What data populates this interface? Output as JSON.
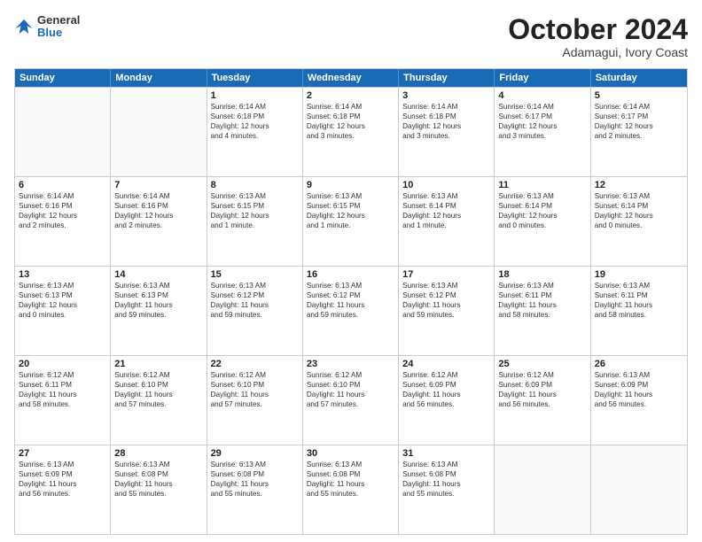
{
  "header": {
    "logo_general": "General",
    "logo_blue": "Blue",
    "month": "October 2024",
    "location": "Adamagui, Ivory Coast"
  },
  "days_of_week": [
    "Sunday",
    "Monday",
    "Tuesday",
    "Wednesday",
    "Thursday",
    "Friday",
    "Saturday"
  ],
  "rows": [
    [
      {
        "day": "",
        "lines": []
      },
      {
        "day": "",
        "lines": []
      },
      {
        "day": "1",
        "lines": [
          "Sunrise: 6:14 AM",
          "Sunset: 6:18 PM",
          "Daylight: 12 hours",
          "and 4 minutes."
        ]
      },
      {
        "day": "2",
        "lines": [
          "Sunrise: 6:14 AM",
          "Sunset: 6:18 PM",
          "Daylight: 12 hours",
          "and 3 minutes."
        ]
      },
      {
        "day": "3",
        "lines": [
          "Sunrise: 6:14 AM",
          "Sunset: 6:18 PM",
          "Daylight: 12 hours",
          "and 3 minutes."
        ]
      },
      {
        "day": "4",
        "lines": [
          "Sunrise: 6:14 AM",
          "Sunset: 6:17 PM",
          "Daylight: 12 hours",
          "and 3 minutes."
        ]
      },
      {
        "day": "5",
        "lines": [
          "Sunrise: 6:14 AM",
          "Sunset: 6:17 PM",
          "Daylight: 12 hours",
          "and 2 minutes."
        ]
      }
    ],
    [
      {
        "day": "6",
        "lines": [
          "Sunrise: 6:14 AM",
          "Sunset: 6:16 PM",
          "Daylight: 12 hours",
          "and 2 minutes."
        ]
      },
      {
        "day": "7",
        "lines": [
          "Sunrise: 6:14 AM",
          "Sunset: 6:16 PM",
          "Daylight: 12 hours",
          "and 2 minutes."
        ]
      },
      {
        "day": "8",
        "lines": [
          "Sunrise: 6:13 AM",
          "Sunset: 6:15 PM",
          "Daylight: 12 hours",
          "and 1 minute."
        ]
      },
      {
        "day": "9",
        "lines": [
          "Sunrise: 6:13 AM",
          "Sunset: 6:15 PM",
          "Daylight: 12 hours",
          "and 1 minute."
        ]
      },
      {
        "day": "10",
        "lines": [
          "Sunrise: 6:13 AM",
          "Sunset: 6:14 PM",
          "Daylight: 12 hours",
          "and 1 minute."
        ]
      },
      {
        "day": "11",
        "lines": [
          "Sunrise: 6:13 AM",
          "Sunset: 6:14 PM",
          "Daylight: 12 hours",
          "and 0 minutes."
        ]
      },
      {
        "day": "12",
        "lines": [
          "Sunrise: 6:13 AM",
          "Sunset: 6:14 PM",
          "Daylight: 12 hours",
          "and 0 minutes."
        ]
      }
    ],
    [
      {
        "day": "13",
        "lines": [
          "Sunrise: 6:13 AM",
          "Sunset: 6:13 PM",
          "Daylight: 12 hours",
          "and 0 minutes."
        ]
      },
      {
        "day": "14",
        "lines": [
          "Sunrise: 6:13 AM",
          "Sunset: 6:13 PM",
          "Daylight: 11 hours",
          "and 59 minutes."
        ]
      },
      {
        "day": "15",
        "lines": [
          "Sunrise: 6:13 AM",
          "Sunset: 6:12 PM",
          "Daylight: 11 hours",
          "and 59 minutes."
        ]
      },
      {
        "day": "16",
        "lines": [
          "Sunrise: 6:13 AM",
          "Sunset: 6:12 PM",
          "Daylight: 11 hours",
          "and 59 minutes."
        ]
      },
      {
        "day": "17",
        "lines": [
          "Sunrise: 6:13 AM",
          "Sunset: 6:12 PM",
          "Daylight: 11 hours",
          "and 59 minutes."
        ]
      },
      {
        "day": "18",
        "lines": [
          "Sunrise: 6:13 AM",
          "Sunset: 6:11 PM",
          "Daylight: 11 hours",
          "and 58 minutes."
        ]
      },
      {
        "day": "19",
        "lines": [
          "Sunrise: 6:13 AM",
          "Sunset: 6:11 PM",
          "Daylight: 11 hours",
          "and 58 minutes."
        ]
      }
    ],
    [
      {
        "day": "20",
        "lines": [
          "Sunrise: 6:12 AM",
          "Sunset: 6:11 PM",
          "Daylight: 11 hours",
          "and 58 minutes."
        ]
      },
      {
        "day": "21",
        "lines": [
          "Sunrise: 6:12 AM",
          "Sunset: 6:10 PM",
          "Daylight: 11 hours",
          "and 57 minutes."
        ]
      },
      {
        "day": "22",
        "lines": [
          "Sunrise: 6:12 AM",
          "Sunset: 6:10 PM",
          "Daylight: 11 hours",
          "and 57 minutes."
        ]
      },
      {
        "day": "23",
        "lines": [
          "Sunrise: 6:12 AM",
          "Sunset: 6:10 PM",
          "Daylight: 11 hours",
          "and 57 minutes."
        ]
      },
      {
        "day": "24",
        "lines": [
          "Sunrise: 6:12 AM",
          "Sunset: 6:09 PM",
          "Daylight: 11 hours",
          "and 56 minutes."
        ]
      },
      {
        "day": "25",
        "lines": [
          "Sunrise: 6:12 AM",
          "Sunset: 6:09 PM",
          "Daylight: 11 hours",
          "and 56 minutes."
        ]
      },
      {
        "day": "26",
        "lines": [
          "Sunrise: 6:13 AM",
          "Sunset: 6:09 PM",
          "Daylight: 11 hours",
          "and 56 minutes."
        ]
      }
    ],
    [
      {
        "day": "27",
        "lines": [
          "Sunrise: 6:13 AM",
          "Sunset: 6:09 PM",
          "Daylight: 11 hours",
          "and 56 minutes."
        ]
      },
      {
        "day": "28",
        "lines": [
          "Sunrise: 6:13 AM",
          "Sunset: 6:08 PM",
          "Daylight: 11 hours",
          "and 55 minutes."
        ]
      },
      {
        "day": "29",
        "lines": [
          "Sunrise: 6:13 AM",
          "Sunset: 6:08 PM",
          "Daylight: 11 hours",
          "and 55 minutes."
        ]
      },
      {
        "day": "30",
        "lines": [
          "Sunrise: 6:13 AM",
          "Sunset: 6:08 PM",
          "Daylight: 11 hours",
          "and 55 minutes."
        ]
      },
      {
        "day": "31",
        "lines": [
          "Sunrise: 6:13 AM",
          "Sunset: 6:08 PM",
          "Daylight: 11 hours",
          "and 55 minutes."
        ]
      },
      {
        "day": "",
        "lines": []
      },
      {
        "day": "",
        "lines": []
      }
    ]
  ]
}
